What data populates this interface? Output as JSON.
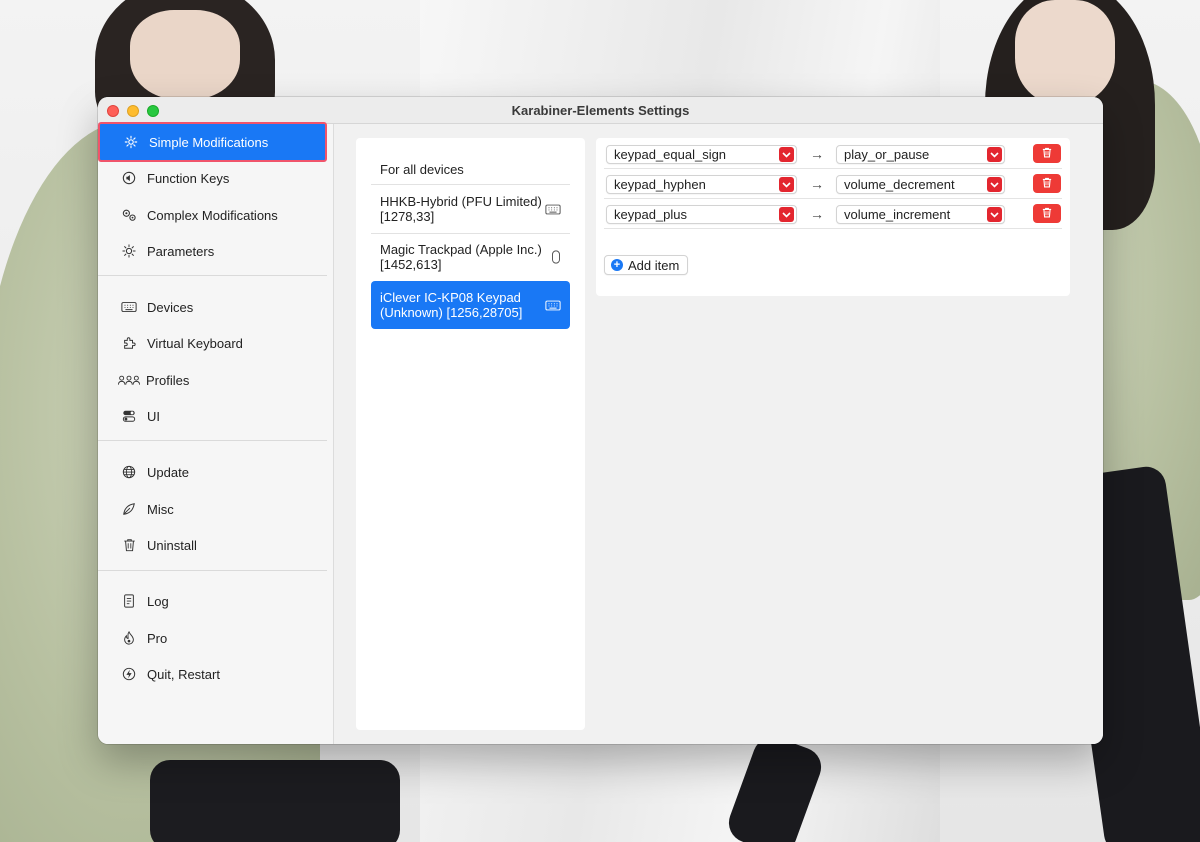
{
  "window": {
    "title": "Karabiner-Elements Settings"
  },
  "sidebar": {
    "items": [
      {
        "label": "Simple Modifications",
        "icon": "gear-icon"
      },
      {
        "label": "Function Keys",
        "icon": "speaker-icon"
      },
      {
        "label": "Complex Modifications",
        "icon": "gears-icon"
      },
      {
        "label": "Parameters",
        "icon": "sun-icon"
      },
      {
        "label": "Devices",
        "icon": "keyboard-icon"
      },
      {
        "label": "Virtual Keyboard",
        "icon": "puzzle-icon"
      },
      {
        "label": "Profiles",
        "icon": "people-icon"
      },
      {
        "label": "UI",
        "icon": "toggle-icon"
      },
      {
        "label": "Update",
        "icon": "globe-icon"
      },
      {
        "label": "Misc",
        "icon": "leaf-icon"
      },
      {
        "label": "Uninstall",
        "icon": "trash-icon"
      },
      {
        "label": "Log",
        "icon": "document-icon"
      },
      {
        "label": "Pro",
        "icon": "flame-icon"
      },
      {
        "label": "Quit, Restart",
        "icon": "bolt-icon"
      }
    ],
    "active_index": 0
  },
  "devices": {
    "items": [
      {
        "line1": "For all devices",
        "line2": "",
        "icon": ""
      },
      {
        "line1": "HHKB-Hybrid (PFU Limited)",
        "line2": "[1278,33]",
        "icon": "keyboard-icon"
      },
      {
        "line1": "Magic Trackpad (Apple Inc.)",
        "line2": "[1452,613]",
        "icon": "mouse-icon"
      },
      {
        "line1": "iClever IC-KP08 Keypad",
        "line2": "(Unknown) [1256,28705]",
        "icon": "keyboard-icon"
      }
    ],
    "selected_index": 3
  },
  "rules": {
    "arrow": "→",
    "items": [
      {
        "from": "keypad_equal_sign",
        "to": "play_or_pause"
      },
      {
        "from": "keypad_hyphen",
        "to": "volume_decrement"
      },
      {
        "from": "keypad_plus",
        "to": "volume_increment"
      }
    ],
    "add_label": "Add item",
    "accent_color": "#1978f5",
    "danger_color": "#ee3a36"
  }
}
